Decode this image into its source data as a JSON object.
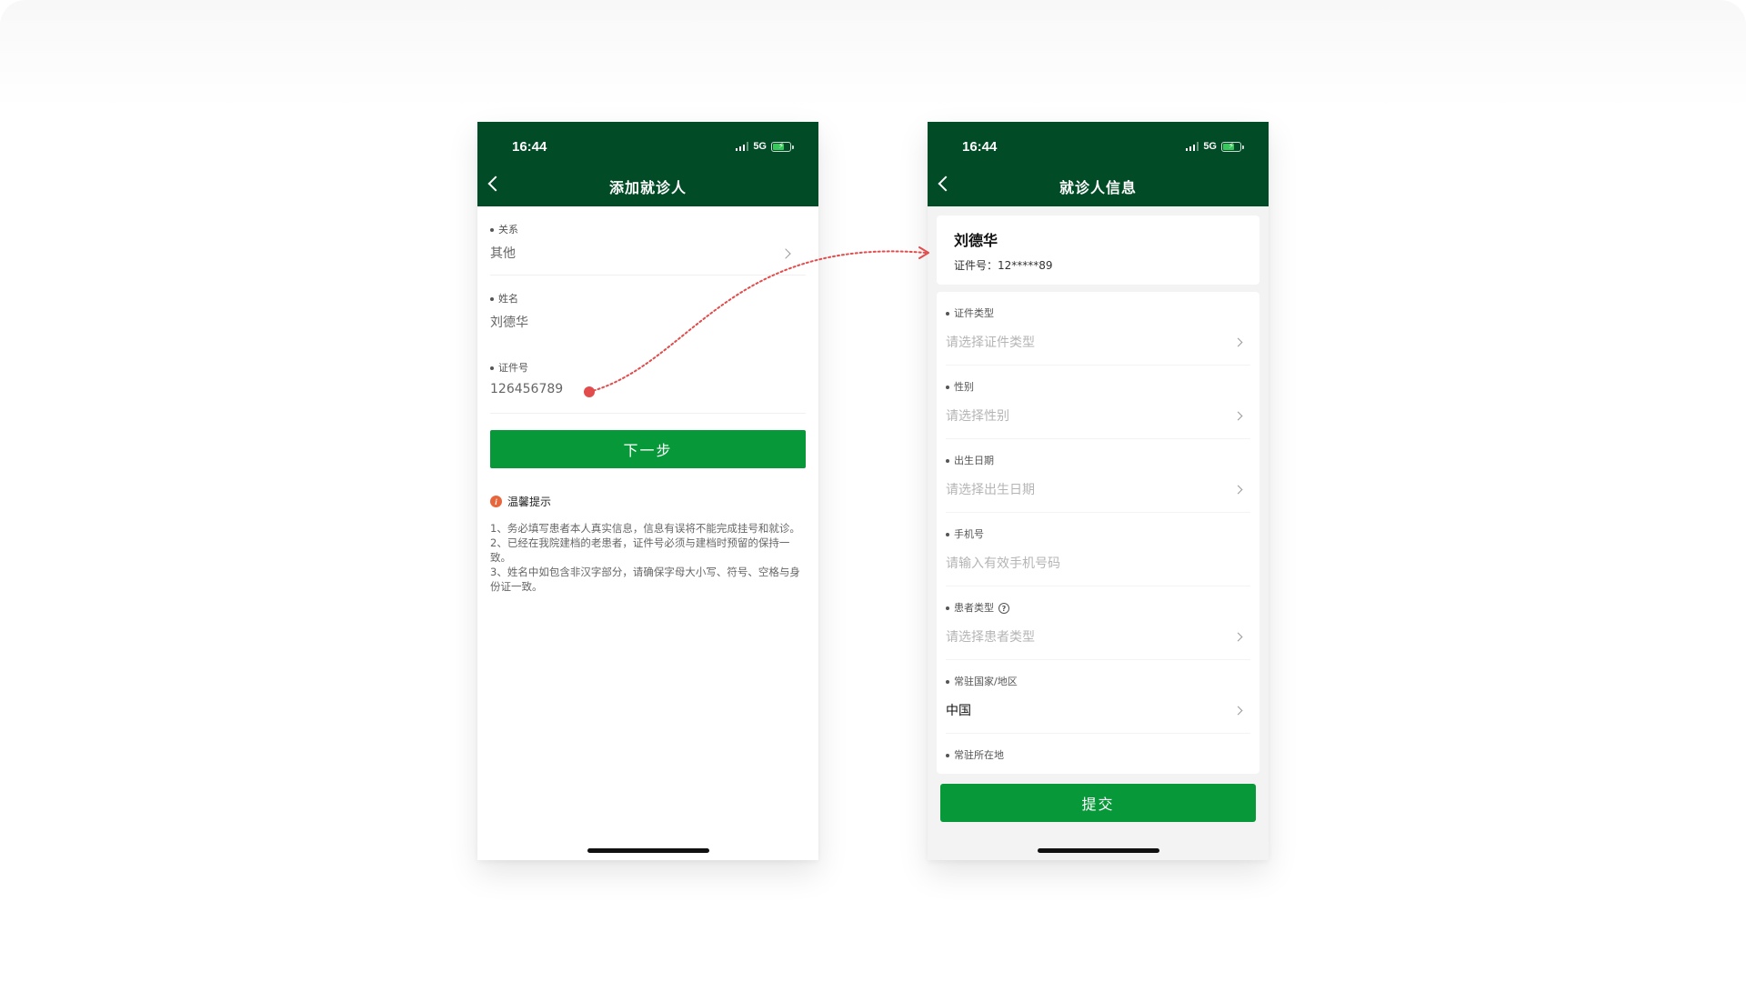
{
  "colors": {
    "header_green": "#014c26",
    "button_green": "#07983a",
    "annotation_red": "#e24c4c",
    "tip_orange": "#e8663c"
  },
  "left_screen": {
    "status": {
      "time": "16:44",
      "network": "5G"
    },
    "header": {
      "title": "添加就诊人",
      "back_icon": "chevron-left-icon"
    },
    "fields": [
      {
        "label": "关系",
        "value": "其他",
        "has_chevron": true
      },
      {
        "label": "姓名",
        "value": "刘德华"
      },
      {
        "label": "证件号",
        "value": "126456789"
      }
    ],
    "next_button": "下一步",
    "tips": {
      "title": "温馨提示",
      "icon_glyph": "i",
      "lines": [
        "1、务必填写患者本人真实信息，信息有误将不能完成挂号和就诊。",
        "2、已经在我院建档的老患者，证件号必须与建档时预留的保持一致。",
        "3、姓名中如包含非汉字部分，请确保字母大小写、符号、空格与身份证一致。"
      ]
    }
  },
  "right_screen": {
    "status": {
      "time": "16:44",
      "network": "5G"
    },
    "header": {
      "title": "就诊人信息",
      "back_icon": "chevron-left-icon"
    },
    "patient": {
      "name": "刘德华",
      "id_text": "证件号：12*****89"
    },
    "fields": [
      {
        "label": "证件类型",
        "value": "请选择证件类型",
        "placeholder": true,
        "has_chevron": true
      },
      {
        "label": "性别",
        "value": "请选择性别",
        "placeholder": true,
        "has_chevron": true
      },
      {
        "label": "出生日期",
        "value": "请选择出生日期",
        "placeholder": true,
        "has_chevron": true
      },
      {
        "label": "手机号",
        "value": "请输入有效手机号码",
        "placeholder": true,
        "has_chevron": false
      },
      {
        "label": "患者类型",
        "value": "请选择患者类型",
        "placeholder": true,
        "has_chevron": true,
        "help": "?"
      },
      {
        "label": "常驻国家/地区",
        "value": "中国",
        "placeholder": false,
        "has_chevron": true
      },
      {
        "label": "常驻所在地",
        "value": "",
        "placeholder": true,
        "has_chevron": false
      }
    ],
    "submit_button": "提交"
  }
}
